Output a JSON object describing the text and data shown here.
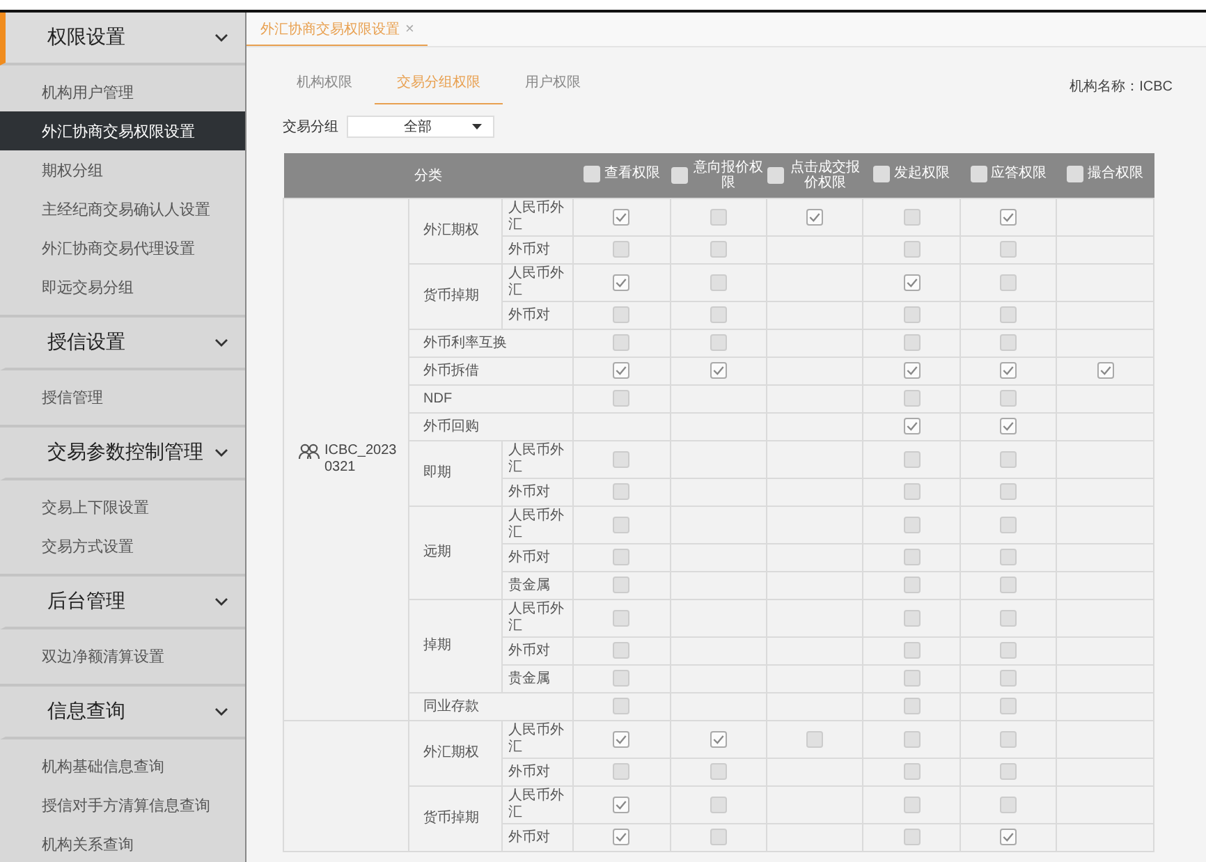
{
  "sidebar": {
    "sections": [
      {
        "title": "权限设置",
        "selected": true,
        "expanded": true,
        "items": [
          {
            "label": "机构用户管理",
            "selected": false
          },
          {
            "label": "外汇协商交易权限设置",
            "selected": true
          },
          {
            "label": "期权分组",
            "selected": false
          },
          {
            "label": "主经纪商交易确认人设置",
            "selected": false
          },
          {
            "label": "外汇协商交易代理设置",
            "selected": false
          },
          {
            "label": "即远交易分组",
            "selected": false
          }
        ]
      },
      {
        "title": "授信设置",
        "selected": false,
        "expanded": true,
        "items": [
          {
            "label": "授信管理",
            "selected": false
          }
        ]
      },
      {
        "title": "交易参数控制管理",
        "selected": false,
        "expanded": true,
        "items": [
          {
            "label": "交易上下限设置",
            "selected": false
          },
          {
            "label": "交易方式设置",
            "selected": false
          }
        ]
      },
      {
        "title": "后台管理",
        "selected": false,
        "expanded": true,
        "items": [
          {
            "label": "双边净额清算设置",
            "selected": false
          }
        ]
      },
      {
        "title": "信息查询",
        "selected": false,
        "expanded": true,
        "items": [
          {
            "label": "机构基础信息查询",
            "selected": false
          },
          {
            "label": "授信对手方清算信息查询",
            "selected": false
          },
          {
            "label": "机构关系查询",
            "selected": false
          }
        ]
      }
    ]
  },
  "page_tabs": [
    {
      "label": "外汇协商交易权限设置",
      "close": "×",
      "selected": true
    }
  ],
  "sub_tabs": [
    {
      "label": "机构权限",
      "selected": false
    },
    {
      "label": "交易分组权限",
      "selected": true
    },
    {
      "label": "用户权限",
      "selected": false
    }
  ],
  "institution": "机构名称：ICBC",
  "filter": {
    "label": "交易分组",
    "value": "全部"
  },
  "table": {
    "category_header": "分类",
    "columns": [
      {
        "label": "查看权限",
        "checked": false
      },
      {
        "label": "意向报价权限",
        "checked": false
      },
      {
        "label": "点击成交报价权限",
        "checked": false
      },
      {
        "label": "发起权限",
        "checked": false
      },
      {
        "label": "应答权限",
        "checked": false
      },
      {
        "label": "撮合权限",
        "checked": false
      }
    ],
    "groups": [
      {
        "name": "ICBC_20230321",
        "categories": [
          {
            "name": "外汇期权",
            "rows": [
              {
                "name": "人民币外汇",
                "cells": [
                  {
                    "checked": true
                  },
                  {
                    "checked": false
                  },
                  {
                    "checked": true
                  },
                  {
                    "checked": false
                  },
                  {
                    "checked": true
                  },
                  null
                ]
              },
              {
                "name": "外币对",
                "cells": [
                  {
                    "checked": false
                  },
                  {
                    "checked": false
                  },
                  null,
                  {
                    "checked": false
                  },
                  {
                    "checked": false
                  },
                  null
                ]
              }
            ]
          },
          {
            "name": "货币掉期",
            "rows": [
              {
                "name": "人民币外汇",
                "cells": [
                  {
                    "checked": true
                  },
                  {
                    "checked": false
                  },
                  null,
                  {
                    "checked": true
                  },
                  {
                    "checked": false
                  },
                  null
                ]
              },
              {
                "name": "外币对",
                "cells": [
                  {
                    "checked": false
                  },
                  {
                    "checked": false
                  },
                  null,
                  {
                    "checked": false
                  },
                  {
                    "checked": false
                  },
                  null
                ]
              }
            ]
          },
          {
            "name": "外币利率互换",
            "cells": [
              {
                "checked": false
              },
              {
                "checked": false
              },
              null,
              {
                "checked": false
              },
              {
                "checked": false
              },
              null
            ]
          },
          {
            "name": "外币拆借",
            "cells": [
              {
                "checked": true
              },
              {
                "checked": true
              },
              null,
              {
                "checked": true
              },
              {
                "checked": true
              },
              {
                "checked": true
              }
            ]
          },
          {
            "name": "NDF",
            "cells": [
              {
                "checked": false
              },
              null,
              null,
              {
                "checked": false
              },
              {
                "checked": false
              },
              null
            ]
          },
          {
            "name": "外币回购",
            "cells": [
              null,
              null,
              null,
              {
                "checked": true
              },
              {
                "checked": true
              },
              null
            ]
          },
          {
            "name": "即期",
            "rows": [
              {
                "name": "人民币外汇",
                "cells": [
                  {
                    "checked": false
                  },
                  null,
                  null,
                  {
                    "checked": false
                  },
                  {
                    "checked": false
                  },
                  null
                ]
              },
              {
                "name": "外币对",
                "cells": [
                  {
                    "checked": false
                  },
                  null,
                  null,
                  {
                    "checked": false
                  },
                  {
                    "checked": false
                  },
                  null
                ]
              }
            ]
          },
          {
            "name": "远期",
            "rows": [
              {
                "name": "人民币外汇",
                "cells": [
                  {
                    "checked": false
                  },
                  null,
                  null,
                  {
                    "checked": false
                  },
                  {
                    "checked": false
                  },
                  null
                ]
              },
              {
                "name": "外币对",
                "cells": [
                  {
                    "checked": false
                  },
                  null,
                  null,
                  {
                    "checked": false
                  },
                  {
                    "checked": false
                  },
                  null
                ]
              },
              {
                "name": "贵金属",
                "cells": [
                  {
                    "checked": false
                  },
                  null,
                  null,
                  {
                    "checked": false
                  },
                  {
                    "checked": false
                  },
                  null
                ]
              }
            ]
          },
          {
            "name": "掉期",
            "rows": [
              {
                "name": "人民币外汇",
                "cells": [
                  {
                    "checked": false
                  },
                  null,
                  null,
                  {
                    "checked": false
                  },
                  {
                    "checked": false
                  },
                  null
                ]
              },
              {
                "name": "外币对",
                "cells": [
                  {
                    "checked": false
                  },
                  null,
                  null,
                  {
                    "checked": false
                  },
                  {
                    "checked": false
                  },
                  null
                ]
              },
              {
                "name": "贵金属",
                "cells": [
                  {
                    "checked": false
                  },
                  null,
                  null,
                  {
                    "checked": false
                  },
                  {
                    "checked": false
                  },
                  null
                ]
              }
            ]
          },
          {
            "name": "同业存款",
            "cells": [
              {
                "checked": false
              },
              null,
              null,
              {
                "checked": false
              },
              {
                "checked": false
              },
              null
            ]
          }
        ]
      },
      {
        "categories": [
          {
            "name": "外汇期权",
            "rows": [
              {
                "name": "人民币外汇",
                "cells": [
                  {
                    "checked": true
                  },
                  {
                    "checked": true
                  },
                  {
                    "checked": false
                  },
                  {
                    "checked": false
                  },
                  {
                    "checked": false
                  },
                  null
                ]
              },
              {
                "name": "外币对",
                "cells": [
                  {
                    "checked": false
                  },
                  {
                    "checked": false
                  },
                  null,
                  {
                    "checked": false
                  },
                  {
                    "checked": false
                  },
                  null
                ]
              }
            ]
          },
          {
            "name": "货币掉期",
            "rows": [
              {
                "name": "人民币外汇",
                "cells": [
                  {
                    "checked": true
                  },
                  {
                    "checked": false
                  },
                  null,
                  {
                    "checked": false
                  },
                  {
                    "checked": false
                  },
                  null
                ]
              },
              {
                "name": "外币对",
                "cells": [
                  {
                    "checked": true
                  },
                  {
                    "checked": false
                  },
                  null,
                  {
                    "checked": false
                  },
                  {
                    "checked": true
                  },
                  null
                ]
              }
            ]
          }
        ]
      }
    ]
  }
}
